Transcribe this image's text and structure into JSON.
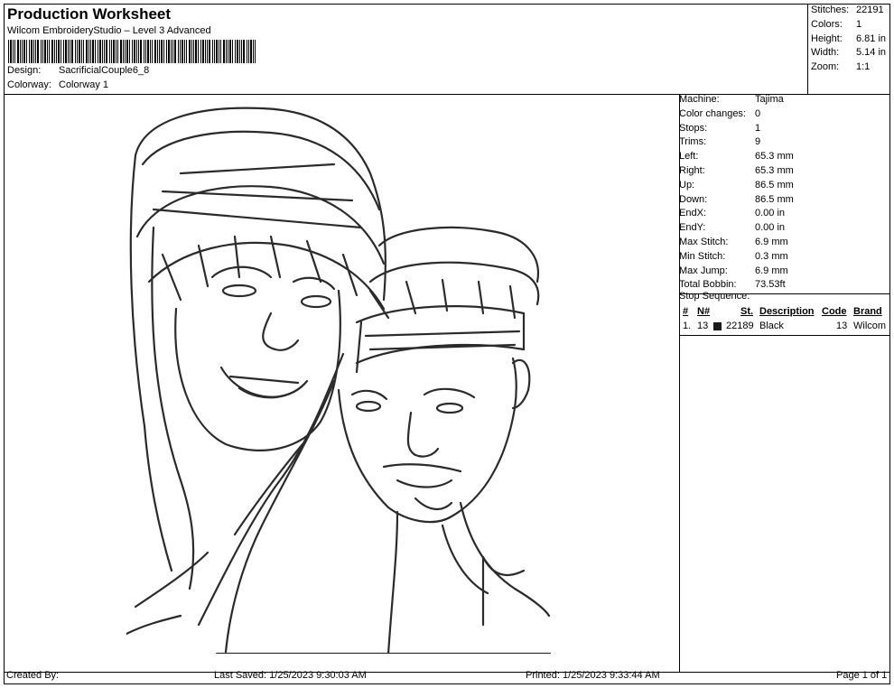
{
  "header": {
    "title": "Production Worksheet",
    "software": "Wilcom EmbroideryStudio – Level 3 Advanced",
    "design_label": "Design:",
    "design_value": "SacrificialCouple6_8",
    "colorway_label": "Colorway:",
    "colorway_value": "Colorway 1"
  },
  "summary": [
    {
      "label": "Stitches:",
      "value": "22191"
    },
    {
      "label": "Colors:",
      "value": "1"
    },
    {
      "label": "Height:",
      "value": "6.81 in"
    },
    {
      "label": "Width:",
      "value": "5.14 in"
    },
    {
      "label": "Zoom:",
      "value": "1:1"
    }
  ],
  "machine_info": [
    {
      "label": "Machine:",
      "value": "Tajima"
    },
    {
      "label": "Color changes:",
      "value": "0"
    },
    {
      "label": "Stops:",
      "value": "1"
    },
    {
      "label": "Trims:",
      "value": "9"
    },
    {
      "label": "Left:",
      "value": "65.3 mm"
    },
    {
      "label": "Right:",
      "value": "65.3 mm"
    },
    {
      "label": "Up:",
      "value": "86.5 mm"
    },
    {
      "label": "Down:",
      "value": "86.5 mm"
    },
    {
      "label": "EndX:",
      "value": "0.00 in"
    },
    {
      "label": "EndY:",
      "value": "0.00 in"
    },
    {
      "label": "Max Stitch:",
      "value": "6.9 mm"
    },
    {
      "label": "Min Stitch:",
      "value": "0.3 mm"
    },
    {
      "label": "Max Jump:",
      "value": "6.9 mm"
    },
    {
      "label": "Total Bobbin:",
      "value": "73.53ft"
    }
  ],
  "stop_sequence": {
    "title": "Stop Sequence:",
    "headers": {
      "num": "#",
      "needle": "N#",
      "st": "St.",
      "description": "Description",
      "code": "Code",
      "brand": "Brand"
    },
    "rows": [
      {
        "num": "1.",
        "needle": "13",
        "color": "#1a1a1a",
        "st": "22189",
        "description": "Black",
        "code": "13",
        "brand": "Wilcom"
      }
    ]
  },
  "footer": {
    "created_by": "Created By:",
    "last_saved": "Last Saved: 1/25/2023 9:30:03 AM",
    "printed": "Printed: 1/25/2023 9:33:44 AM",
    "page": "Page 1 of 1"
  },
  "design_preview": {
    "icon": "embroidery-line-art-couple",
    "thread_color": "#2b2b2b"
  }
}
